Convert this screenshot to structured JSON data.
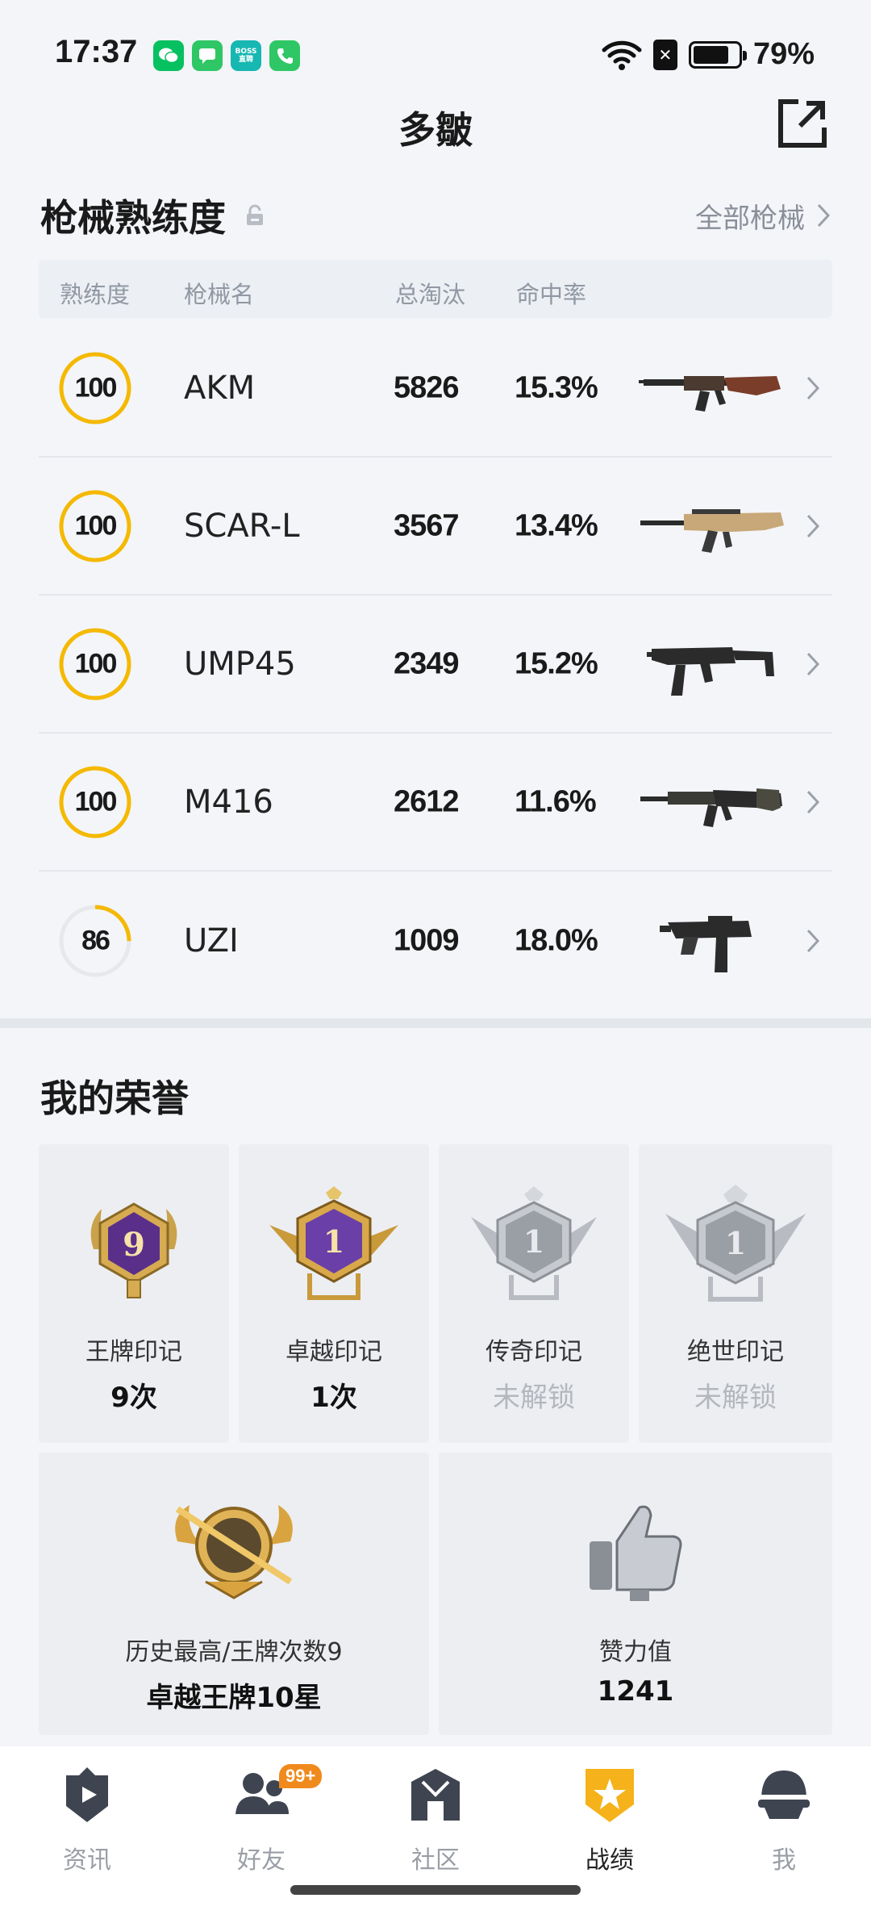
{
  "status_bar": {
    "time": "17:37",
    "battery_pct": "79%",
    "battery_level": 0.79,
    "notifications": [
      "wechat-icon",
      "messages-icon",
      "boss-zhipin-icon",
      "phone-icon"
    ],
    "boss_line1": "BOSS",
    "boss_line2": "直聘"
  },
  "header": {
    "title": "多皺"
  },
  "weapons": {
    "title": "枪械熟练度",
    "all_link": "全部枪械",
    "columns": {
      "proficiency": "熟练度",
      "name": "枪械名",
      "kills": "总淘汰",
      "accuracy": "命中率"
    },
    "rows": [
      {
        "proficiency": "100",
        "level": 1.0,
        "name": "AKM",
        "kills": "5826",
        "accuracy": "15.3%"
      },
      {
        "proficiency": "100",
        "level": 1.0,
        "name": "SCAR-L",
        "kills": "3567",
        "accuracy": "13.4%"
      },
      {
        "proficiency": "100",
        "level": 1.0,
        "name": "UMP45",
        "kills": "2349",
        "accuracy": "15.2%"
      },
      {
        "proficiency": "100",
        "level": 1.0,
        "name": "M416",
        "kills": "2612",
        "accuracy": "11.6%"
      },
      {
        "proficiency": "86",
        "level": 0.25,
        "name": "UZI",
        "kills": "1009",
        "accuracy": "18.0%"
      }
    ]
  },
  "honors": {
    "title": "我的荣誉",
    "marks": [
      {
        "label": "王牌印记",
        "value": "9次",
        "locked": false,
        "icon": "ace-mark-icon"
      },
      {
        "label": "卓越印记",
        "value": "1次",
        "locked": false,
        "icon": "excellence-mark-icon"
      },
      {
        "label": "传奇印记",
        "value": "未解锁",
        "locked": true,
        "icon": "legend-mark-icon"
      },
      {
        "label": "绝世印记",
        "value": "未解锁",
        "locked": true,
        "icon": "peerless-mark-icon"
      }
    ],
    "highest": {
      "label": "历史最高/王牌次数9",
      "value": "卓越王牌10星"
    },
    "likes": {
      "label": "赞力值",
      "value": "1241"
    }
  },
  "tab_bar": {
    "items": [
      {
        "label": "资讯",
        "icon": "news-icon",
        "active": false
      },
      {
        "label": "好友",
        "icon": "friends-icon",
        "active": false,
        "badge": "99+"
      },
      {
        "label": "社区",
        "icon": "community-icon",
        "active": false
      },
      {
        "label": "战绩",
        "icon": "records-icon",
        "active": true
      },
      {
        "label": "我",
        "icon": "profile-icon",
        "active": false
      }
    ]
  },
  "colors": {
    "accent_yellow": "#f5b900",
    "ring_track": "#e6e8ec",
    "badge_orange": "#f08a1d"
  }
}
